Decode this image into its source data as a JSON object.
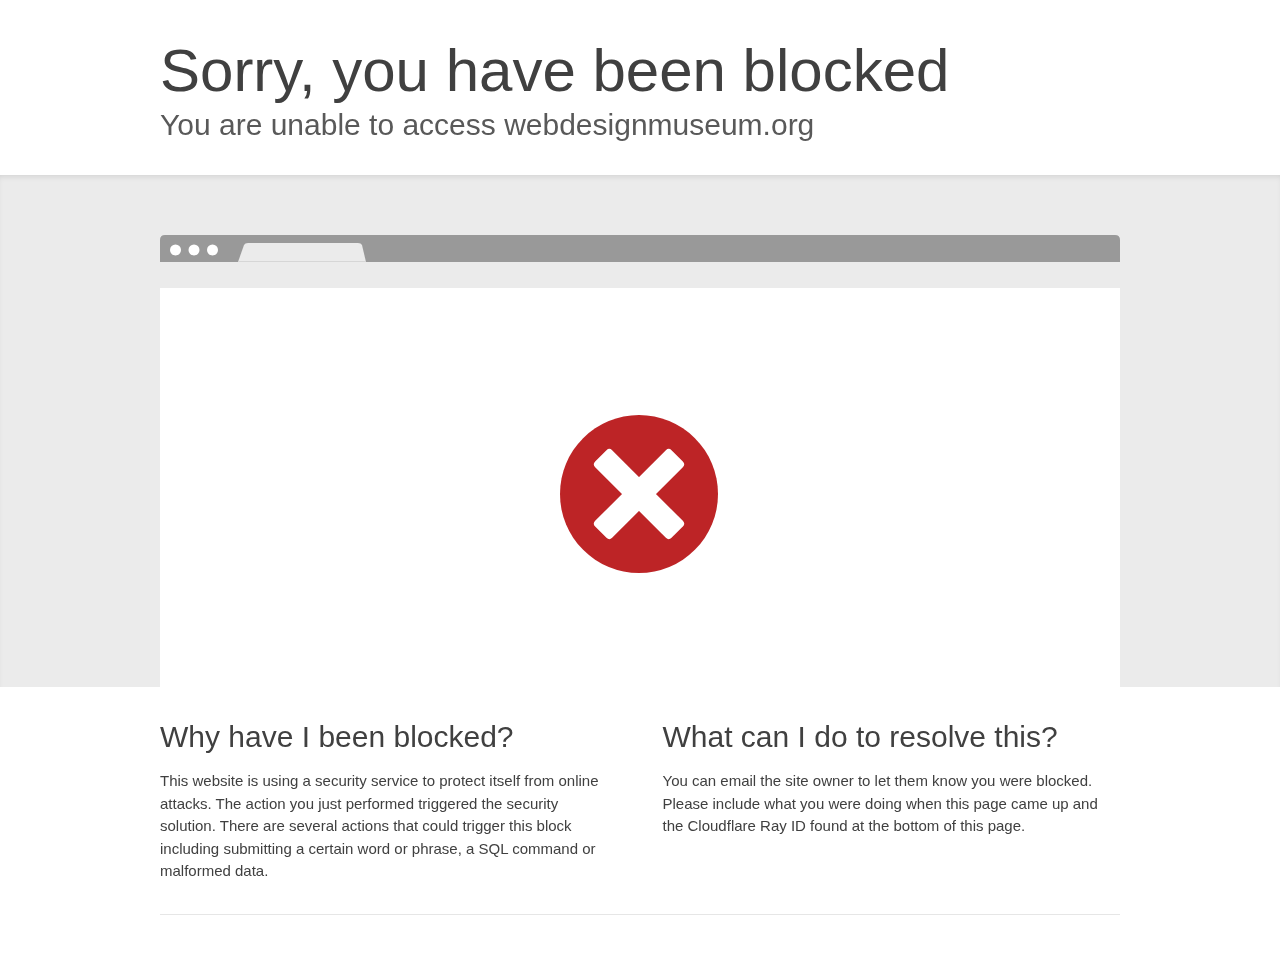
{
  "header": {
    "title": "Sorry, you have been blocked",
    "subtitle": "You are unable to access webdesignmuseum.org"
  },
  "sections": [
    {
      "heading": "Why have I been blocked?",
      "text": "This website is using a security service to protect itself from online attacks. The action you just performed triggered the security solution. There are several actions that could trigger this block including submitting a certain word or phrase, a SQL command or malformed data."
    },
    {
      "heading": "What can I do to resolve this?",
      "text": "You can email the site owner to let them know you were blocked. Please include what you were doing when this page came up and the Cloudflare Ray ID found at the bottom of this page."
    }
  ]
}
